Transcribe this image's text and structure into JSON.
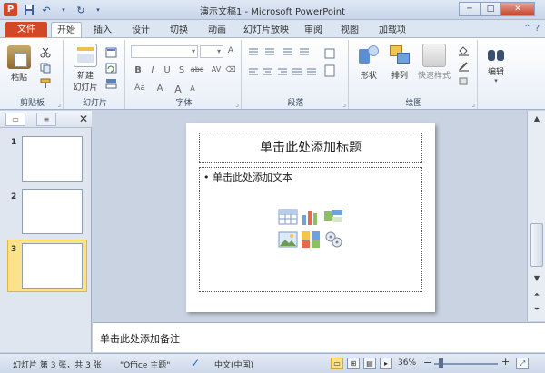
{
  "window": {
    "title": "演示文稿1 - Microsoft PowerPoint",
    "app_icon": "P",
    "controls": [
      "─",
      "□",
      "✕"
    ]
  },
  "ribbon_tabs": [
    "文件",
    "开始",
    "插入",
    "设计",
    "切换",
    "动画",
    "幻灯片放映",
    "审阅",
    "视图",
    "加载项"
  ],
  "ribbon": {
    "clipboard": {
      "label": "剪贴板",
      "paste": "粘贴"
    },
    "slides": {
      "label": "幻灯片",
      "new_slide_line1": "新建",
      "new_slide_line2": "幻灯片"
    },
    "font": {
      "label": "字体",
      "buttons": [
        "B",
        "I",
        "U",
        "S",
        "abc",
        "AV",
        "Aa",
        "A",
        "A",
        "A"
      ]
    },
    "paragraph": {
      "label": "段落"
    },
    "drawing": {
      "label": "绘图",
      "shapes": "形状",
      "arrange": "排列",
      "quick_styles": "快速样式"
    },
    "editing": {
      "label": "编辑",
      "edit": "编辑"
    }
  },
  "slides_panel": {
    "thumbnails": [
      {
        "number": "1"
      },
      {
        "number": "2"
      },
      {
        "number": "3",
        "selected": true
      }
    ]
  },
  "slide": {
    "title_placeholder": "单击此处添加标题",
    "body_placeholder": "• 单击此处添加文本"
  },
  "notes": {
    "placeholder": "单击此处添加备注"
  },
  "status": {
    "slide_info": "幻灯片 第 3 张，共 3 张",
    "theme": "\"Office 主题\"",
    "language": "中文(中国)",
    "zoom": "36%"
  },
  "colors": {
    "accent": "#d24726",
    "selection": "#fbe28b"
  }
}
